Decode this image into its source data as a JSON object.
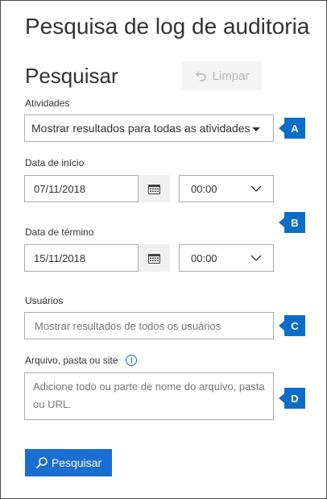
{
  "page": {
    "title": "Pesquisa de log de auditoria"
  },
  "search": {
    "section_title": "Pesquisar",
    "clear_label": "Limpar",
    "submit_label": "Pesquisar"
  },
  "activities": {
    "label": "Atividades",
    "value": "Mostrar resultados para todas as atividades"
  },
  "start_date": {
    "label": "Data de início",
    "date": "07/11/2018",
    "time": "00:00"
  },
  "end_date": {
    "label": "Data de término",
    "date": "15/11/2018",
    "time": "00:00"
  },
  "users": {
    "label": "Usuários",
    "placeholder": "Mostrar resultados de todos os usuários"
  },
  "file": {
    "label": "Arquivo, pasta ou site",
    "info_glyph": "i",
    "placeholder": "Adicione todo ou parte de nome do arquivo, pasta ou URL."
  },
  "callouts": {
    "a": "A",
    "b": "B",
    "c": "C",
    "d": "D"
  },
  "colors": {
    "accent": "#1a6ed2",
    "callout": "#0a6ec8",
    "border": "#ababab"
  },
  "icons": {
    "clear": "undo-icon",
    "calendar": "calendar-icon",
    "chevron": "chevron-down-icon",
    "search": "search-icon",
    "info": "info-icon"
  }
}
